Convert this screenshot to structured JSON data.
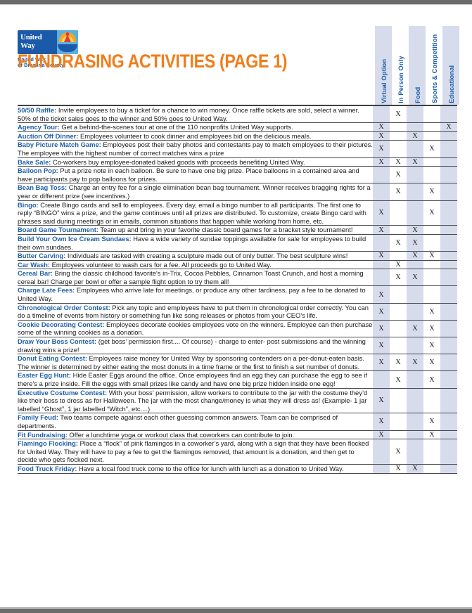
{
  "document": {
    "title": "FUNDRASING ACTIVITIES (PAGE 1)",
    "title_color": "#f07d1a",
    "accent_color": "#1f5fa9",
    "column_shade_color": "#d7dced",
    "mark_symbol": "X"
  },
  "logo": {
    "name": "United Way",
    "word_line1": "United",
    "word_line2": "Way",
    "subtitle_line1": "United Way",
    "subtitle_line2": "of Brazoria County"
  },
  "columns": [
    {
      "label": "Virtual Option",
      "shaded": true
    },
    {
      "label": "In Person Only",
      "shaded": false
    },
    {
      "label": "Food",
      "shaded": true
    },
    {
      "label": "Sports & Competition",
      "shaded": false
    },
    {
      "label": "Educational",
      "shaded": true
    }
  ],
  "rows": [
    {
      "name": "50/50 Raffle:",
      "description": " Invite employees to buy a ticket for a chance to win money. Once raffle tickets are sold, select a winner. 50% of the ticket sales goes to the winner and 50% goes to United Way.",
      "marks": [
        false,
        true,
        false,
        false,
        false
      ]
    },
    {
      "name": "Agency Tour:",
      "description": " Get a behind-the-scenes tour at one of the 110 nonprofits United Way supports.",
      "marks": [
        true,
        false,
        false,
        false,
        true
      ]
    },
    {
      "name": "Auction Off Dinner:",
      "description": " Employees volunteer to cook dinner and employees bid on the delicious meals.",
      "marks": [
        true,
        false,
        true,
        false,
        false
      ]
    },
    {
      "name": "Baby Picture Match Game:",
      "description": " Employees post their baby photos and contestants pay to match employees to their pictures. The employee with the highest number of correct matches wins a prize",
      "marks": [
        true,
        false,
        false,
        true,
        false
      ]
    },
    {
      "name": "Bake Sale:",
      "description": " Co-workers buy employee-donated baked goods with proceeds benefiting United Way.",
      "marks": [
        true,
        true,
        true,
        false,
        false
      ]
    },
    {
      "name": "Balloon Pop:",
      "description": " Put a prize note in each balloon.  Be sure to have one big prize. Place balloons in a contained area and have participants pay to pop balloons for prizes.",
      "marks": [
        false,
        true,
        false,
        false,
        false
      ]
    },
    {
      "name": "Bean Bag Toss:",
      "description": " Charge an entry fee for a single elimination bean bag tournament. Winner receives bragging rights for a year or different prize (see incentives.)",
      "marks": [
        false,
        true,
        false,
        true,
        false
      ]
    },
    {
      "name": "Bingo:",
      "description": " Create Bingo cards and sell to employees. Every day, email a bingo number to all participants. The first one to reply “BINGO” wins a prize, and the game continues until all prizes are distributed. To customize, create  Bingo card with phrases said during meetings or in emails, common situations that happen while working from home, etc.",
      "marks": [
        true,
        false,
        false,
        true,
        false
      ]
    },
    {
      "name": "Board Game Tournament:",
      "description": " Team up and bring in your favorite classic board games for a bracket style tournament!",
      "marks": [
        true,
        false,
        true,
        false,
        false
      ]
    },
    {
      "name": "Build Your Own Ice Cream Sundaes:",
      "description": " Have a wide variety of sundae toppings available for sale for employees to build their own sundaes.",
      "marks": [
        false,
        true,
        true,
        false,
        false
      ]
    },
    {
      "name": "Butter Carving:",
      "description": " Individuals are tasked with creating a sculpture made out of only butter. The best sculpture wins!",
      "marks": [
        true,
        false,
        true,
        true,
        false
      ]
    },
    {
      "name": "Car Wash:",
      "description": " Employees volunteer to wash cars for a fee. All proceeds go to United Way.",
      "marks": [
        false,
        true,
        false,
        false,
        false
      ]
    },
    {
      "name": "Cereal Bar:",
      "description": " Bring the classic childhood favorite's in-Trix, Cocoa Pebbles, Cinnamon Toast Crunch, and host a morning cereal bar! Charge per bowl or offer a sample flight option to try them all!",
      "marks": [
        false,
        true,
        true,
        false,
        false
      ]
    },
    {
      "name": "Charge Late Fees:",
      "description": " Employees who arrive late for meetings, or produce any other tardiness, pay a fee to be donated to United Way.",
      "marks": [
        true,
        false,
        false,
        false,
        false
      ]
    },
    {
      "name": "Chronological Order Contest:",
      "description": " Pick any topic and employees have to put them in chronological order correctly. You can do a timeline of events from history or something fun like song releases or photos from your CEO’s life.",
      "marks": [
        true,
        false,
        false,
        true,
        false
      ]
    },
    {
      "name": "Cookie Decorating Contest:",
      "description": " Employees decorate cookies employees vote on the winners. Employee can then purchase some of the winning cookies as a donation.",
      "marks": [
        true,
        false,
        true,
        true,
        false
      ]
    },
    {
      "name": "Draw Your Boss Contest:",
      "description": " (get boss’ permission first.... Of course) - charge to enter- post submissions and the winning drawing wins a prize!",
      "marks": [
        true,
        false,
        false,
        true,
        false
      ]
    },
    {
      "name": "Donut Eating Contest:",
      "description": " Employees raise money for United Way by sponsoring contenders on a per-donut-eaten basis. The winner is determined by either eating the most donuts in a time frame or the first to finish a set number of donuts.",
      "marks": [
        true,
        true,
        true,
        true,
        false
      ]
    },
    {
      "name": "Easter Egg Hunt:",
      "description": " Hide Easter Eggs around the office. Once employees find an egg they can purchase the egg to see if there’s a prize inside. Fill the eggs with small prizes like candy and have one big prize hidden inside one egg!",
      "marks": [
        false,
        true,
        false,
        true,
        false
      ]
    },
    {
      "name": "Executive Costume Contest:",
      "description": " With your boss’ permission, allow workers to contribute to the jar with the costume they’d like their boss to dress as for Halloween. The jar with the most change/money is what they will dress as! (Example- 1 jar labelled “Ghost”, 1 jar labelled “Witch”, etc....)",
      "marks": [
        true,
        false,
        false,
        false,
        false
      ]
    },
    {
      "name": "Family Feud:",
      "description": " Two teams compete against each other guessing common answers. Team can be comprised of departments.",
      "marks": [
        true,
        false,
        false,
        true,
        false
      ]
    },
    {
      "name": "Fit Fundraising:",
      "description": " Offer a lunchtime yoga or workout class that coworkers can contribute to join.",
      "marks": [
        true,
        false,
        false,
        true,
        false
      ]
    },
    {
      "name": "Flamingo Flocking:",
      "description": " Place a “flock” of pink flamingos in a coworker’s yard, along with a sign that they have been flocked for United Way. They will have to pay a fee to get the flamingos removed, that amount is a donation, and then get to decide who gets flocked next.",
      "marks": [
        false,
        true,
        false,
        false,
        false
      ]
    },
    {
      "name": "Food Truck Friday:",
      "description": " Have a local food truck come to the office for lunch with lunch as a donation to United Way.",
      "marks": [
        false,
        true,
        true,
        false,
        false
      ]
    }
  ]
}
